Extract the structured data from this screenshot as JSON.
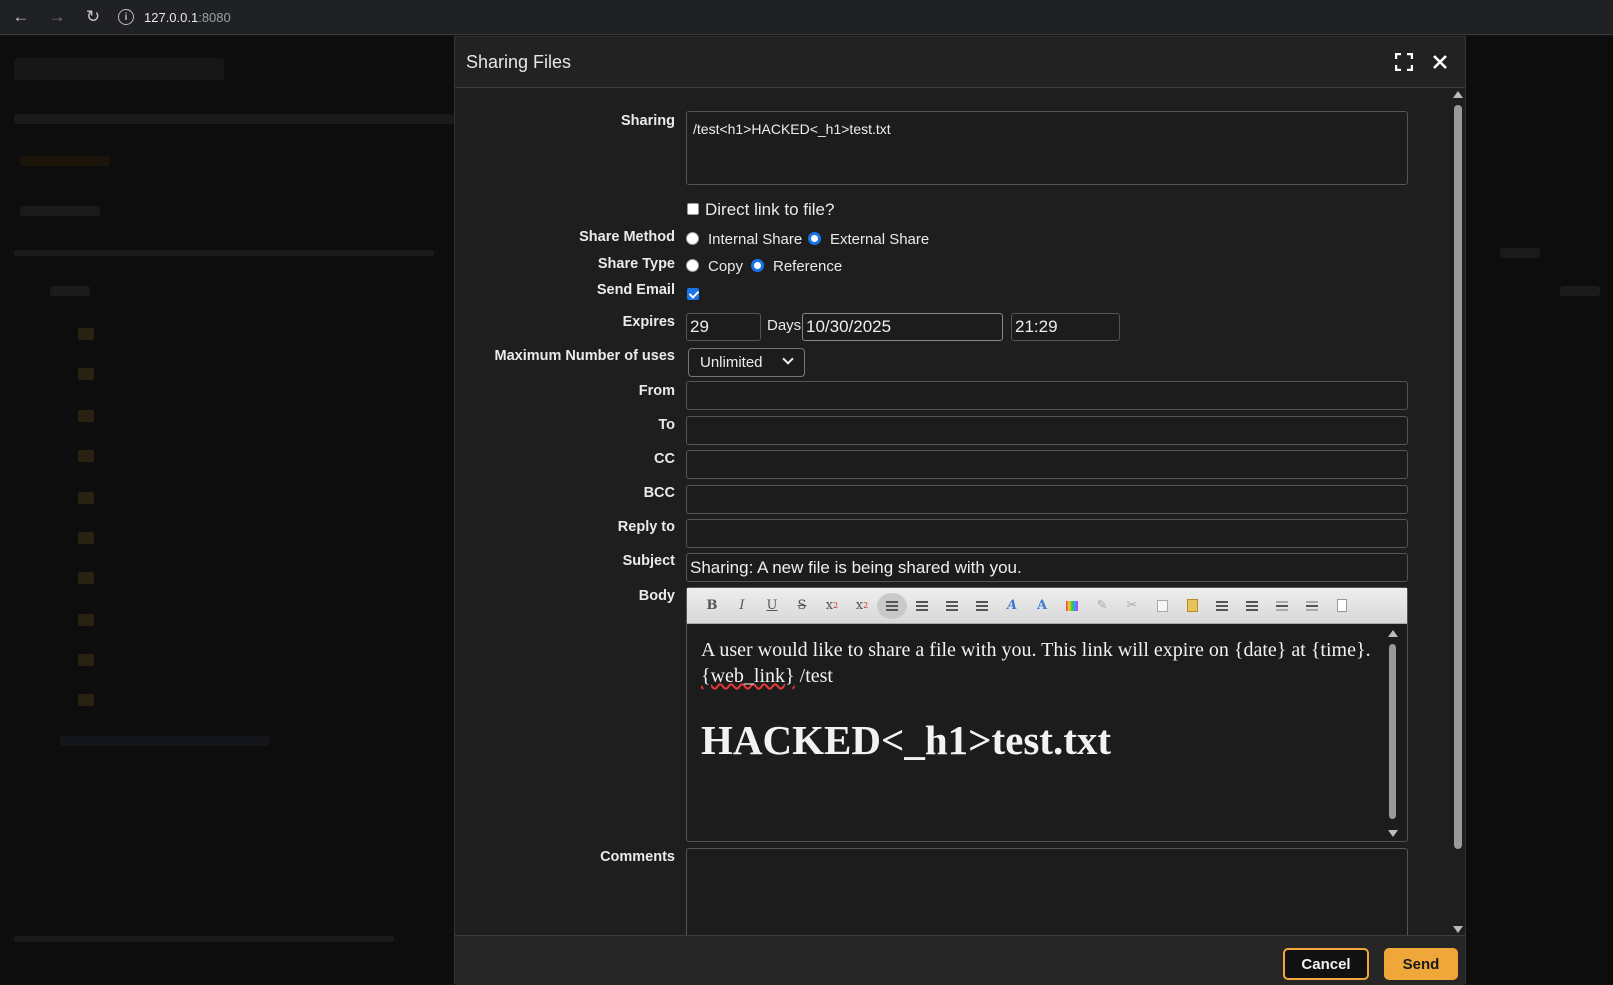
{
  "browser": {
    "url_host": "127.0.0.1",
    "url_port": ":8080",
    "back_icon": "arrow-left-icon",
    "forward_icon": "arrow-right-icon",
    "reload_icon": "reload-icon"
  },
  "modal": {
    "title": "Sharing Files",
    "labels": {
      "sharing": "Sharing",
      "share_method": "Share Method",
      "share_type": "Share Type",
      "send_email": "Send Email",
      "expires": "Expires",
      "max_uses": "Maximum Number of uses",
      "from": "From",
      "to": "To",
      "cc": "CC",
      "bcc": "BCC",
      "reply_to": "Reply to",
      "subject": "Subject",
      "body": "Body",
      "comments": "Comments"
    },
    "sharing_path": "/test<h1>HACKED<_h1>test.txt",
    "direct_link_label": "Direct link to file?",
    "direct_link_checked": false,
    "share_method": {
      "internal": "Internal Share",
      "external": "External Share",
      "selected": "external"
    },
    "share_type": {
      "copy": "Copy",
      "reference": "Reference",
      "selected": "reference"
    },
    "send_email_checked": true,
    "expires": {
      "days_value": "29",
      "days_label": "Days",
      "date": "10/30/2025",
      "time": "21:29"
    },
    "max_uses_value": "Unlimited",
    "from_value": "",
    "to_value": "",
    "cc_value": "",
    "bcc_value": "",
    "reply_to_value": "",
    "subject_value": "Sharing: A new file is being shared with you.",
    "body": {
      "text_before": "A user would like to share a file with you. This link will expire on {date} at {time}. ",
      "web_link": "{web_link}",
      "text_after": " /test",
      "heading": "HACKED<_h1>test.txt"
    },
    "toolbar_icons": [
      "bold-icon",
      "italic-icon",
      "underline-icon",
      "strikethrough-icon",
      "subscript-icon",
      "superscript-icon",
      "align-left-icon",
      "align-center-icon",
      "align-right-icon",
      "align-justify-icon",
      "font-icon",
      "font-size-icon",
      "color-picker-icon",
      "highlight-icon",
      "cut-icon",
      "copy-icon",
      "paste-icon",
      "unordered-list-icon",
      "ordered-list-icon",
      "outdent-icon",
      "indent-icon",
      "source-icon"
    ],
    "comments_value": "",
    "buttons": {
      "cancel": "Cancel",
      "send": "Send"
    },
    "accent_color": "#f0a73a"
  }
}
